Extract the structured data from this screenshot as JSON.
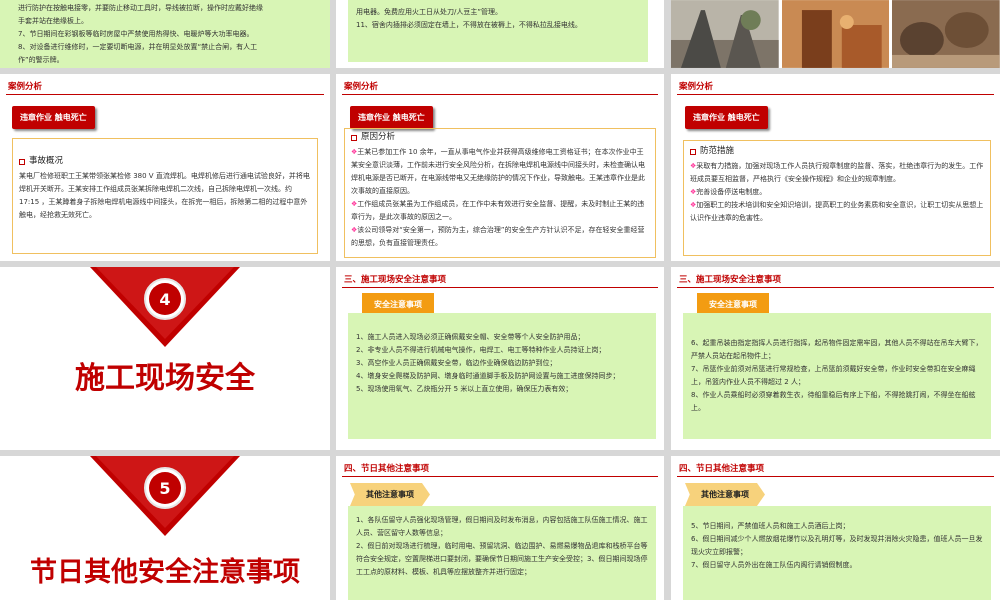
{
  "row1": {
    "left_lines": [
      "进行防护在按触电接零，并要防止移动工具时，导线被拉断，操作时应戴好绝缘",
      "手套并站在绝缘板上。",
      "7、节日期间在彩钢板等临时房屋中严禁使用热得快、电暖炉等大功率电器。",
      "8、对设备进行维修时，一定要切断电源，并在明显处放置“禁止合闸，有人工",
      "作”的警示牌。"
    ],
    "mid_lines": [
      "用电器。免费应用火工日从处刀/人豆主”管理。",
      "11、宿舍内插排必须固定在墙上，不得放在被褥上，不得私拉乱接电线。"
    ]
  },
  "case": {
    "section_title": "案例分析",
    "badge": "违章作业  触电死亡",
    "left": {
      "heading": "事故概况",
      "text": "某电厂检修班职工王某带领张某检修 380 V 直流焊机。电焊机修后进行通电试验良好，并将电焊机开关断开。王某安排工作组成员张某拆除电焊机二次线，自己拆除电焊机一次线。约 17:15 ，王某蹲着身子拆除电焊机电源线中间接头，在拆完一相后，拆除第二相的过程中意外触电，经抢救无效死亡。"
    },
    "mid": {
      "heading": "原因分析",
      "items": [
        "王某已参加工作 10 余年，一直从事电气作业并获得高级维修电工资格证书；在本次作业中王某安全意识淡薄，工作前未进行安全风险分析，在拆除电焊机电源线中间接头时，未检查确认电焊机电源是否已断开，在电源线带电又无绝缘防护的情况下作业，导致触电。王某违章作业是此次事故的直接原因。",
        "工作组成员张某虽为工作组成员，在工作中未有效进行安全监督、提醒，未及时制止王某的违章行为，是此次事故的原因之一。",
        "该公司领导对“安全第一，预防为主，综合治理”的安全生产方针认识不足，存在轻安全重经营的思想，负有直接管理责任。"
      ]
    },
    "right": {
      "heading": "防范措施",
      "items": [
        "采取有力措施，加强对现场工作人员执行规章制度的监督、落实，杜绝违章行为的发生。工作班成员要互相监督，严格执行《安全操作规程》和企业的规章制度。",
        "完善设备停送电制度。",
        "加强职工的技术培训和安全知识培训，提高职工的业务素质和安全意识，让职工切实从思想上认识作业违章的危害性。"
      ]
    }
  },
  "site": {
    "number": "4",
    "title": "施工现场安全",
    "section_title": "三、施工现场安全注意事项",
    "tab": "安全注意事项",
    "mid_lines": [
      "1、施工人员进入现场必须正确佩戴安全帽、安全带等个人安全防护用品；",
      "2、非专业人员不得进行机械电气操作，电焊工、电工等特种作业人员持证上岗；",
      "3、高空作业人员正确佩戴安全带，临边作业确保临边防护到位；",
      "4、墩身安全爬梯及防护网、墩身临时通道脚手板及防护网设置与施工进度保持同步；",
      "5、现场使用氧气、乙炔瓶分开 5 米以上直立使用，确保压力表有效；"
    ],
    "right_lines": [
      "6、起重吊装由指定指挥人员进行指挥，起吊物件固定需牢固，其他人员不得站在吊车大臂下，严禁人员站在起吊物件上；",
      "7、吊篮作业前须对吊篮进行常规检查，上吊篮前须戴好安全带，作业时安全带扣在安全麻绳上，吊篮内作业人员不得超过 2 人；",
      "8、作业人员乘船时必须穿着救生衣，待船靠稳后有序上下船，不得抢跳打闹，不得坐在船舷上。"
    ]
  },
  "holiday": {
    "number": "5",
    "title": "节日其他安全注意事项",
    "section_title": "四、节日其他注意事项",
    "tab": "其他注意事项",
    "mid_lines": [
      "1、各队伍留守人员强化现场管理，假日期间及时发布消息，内容包括施工队伍施工情况、施工人员、营区留守人数等信息；",
      "2、假日前对现场进行梳理，临时用电、预留坑洞、临边围护、易燃易爆物品退库和栈桥平台等符合安全规定，空置爬梯进口要封闭，要确保节日期间施工生产安全受控；3、假日期间现场停工工点的原材料、模板、机具等应摆放整齐并进行固定；"
    ],
    "right_lines": [
      "5、节日期间，严禁值班人员和施工人员酒后上岗；",
      "6、假日期间减少个人燃放烟花爆竹以及孔明灯等，及时发现并消除火灾隐患，值班人员一旦发现火灾立即报警；",
      "7、假日留守人员外出在施工队伍内阁行请销假制度。"
    ]
  },
  "colors": {
    "red": "#c00000",
    "green_box": "#d8f5b5",
    "orange": "#f39c12"
  }
}
